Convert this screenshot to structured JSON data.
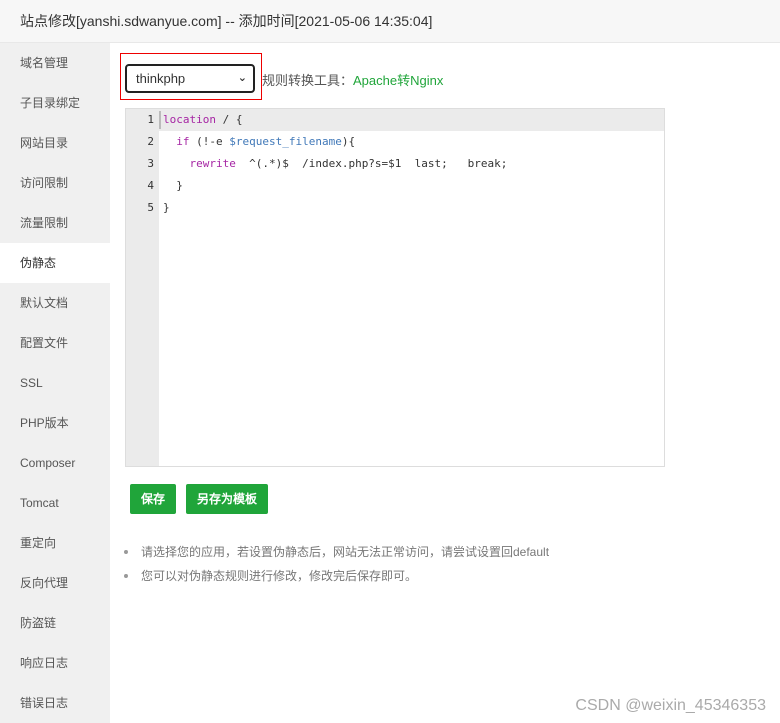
{
  "window": {
    "title": "站点修改[yanshi.sdwanyue.com] -- 添加时间[2021-05-06 14:35:04]"
  },
  "sidebar": {
    "active": "伪静态",
    "items": [
      "域名管理",
      "子目录绑定",
      "网站目录",
      "访问限制",
      "流量限制",
      "伪静态",
      "默认文档",
      "配置文件",
      "SSL",
      "PHP版本",
      "Composer",
      "Tomcat",
      "重定向",
      "反向代理",
      "防盗链",
      "响应日志",
      "错误日志"
    ]
  },
  "main": {
    "template_select": {
      "value": "thinkphp",
      "icon": "chevron-down-icon"
    },
    "converter_label": "规则转换工具：",
    "converter_link": "Apache转Nginx",
    "editor": {
      "line_numbers": [
        "1",
        "2",
        "3",
        "4",
        "5"
      ],
      "lines": [
        [
          {
            "t": "location",
            "c": "kw"
          },
          {
            "t": " / {",
            "c": ""
          }
        ],
        [
          {
            "t": "  ",
            "c": ""
          },
          {
            "t": "if",
            "c": "kw"
          },
          {
            "t": " (!-e ",
            "c": ""
          },
          {
            "t": "$request_filename",
            "c": "var"
          },
          {
            "t": "){",
            "c": ""
          }
        ],
        [
          {
            "t": "    ",
            "c": ""
          },
          {
            "t": "rewrite",
            "c": "kw"
          },
          {
            "t": "  ^(.*)$  /index.php?s=$1  last;   break;",
            "c": ""
          }
        ],
        [
          {
            "t": "  }",
            "c": ""
          }
        ],
        [
          {
            "t": "}",
            "c": ""
          }
        ]
      ]
    },
    "save_label": "保存",
    "save_template_label": "另存为模板",
    "tips": [
      "请选择您的应用，若设置伪静态后，网站无法正常访问，请尝试设置回default",
      "您可以对伪静态规则进行修改，修改完后保存即可。"
    ]
  },
  "watermark": "CSDN @weixin_45346353",
  "colors": {
    "accent": "#20a53a",
    "highlight_border": "#ee0000"
  }
}
